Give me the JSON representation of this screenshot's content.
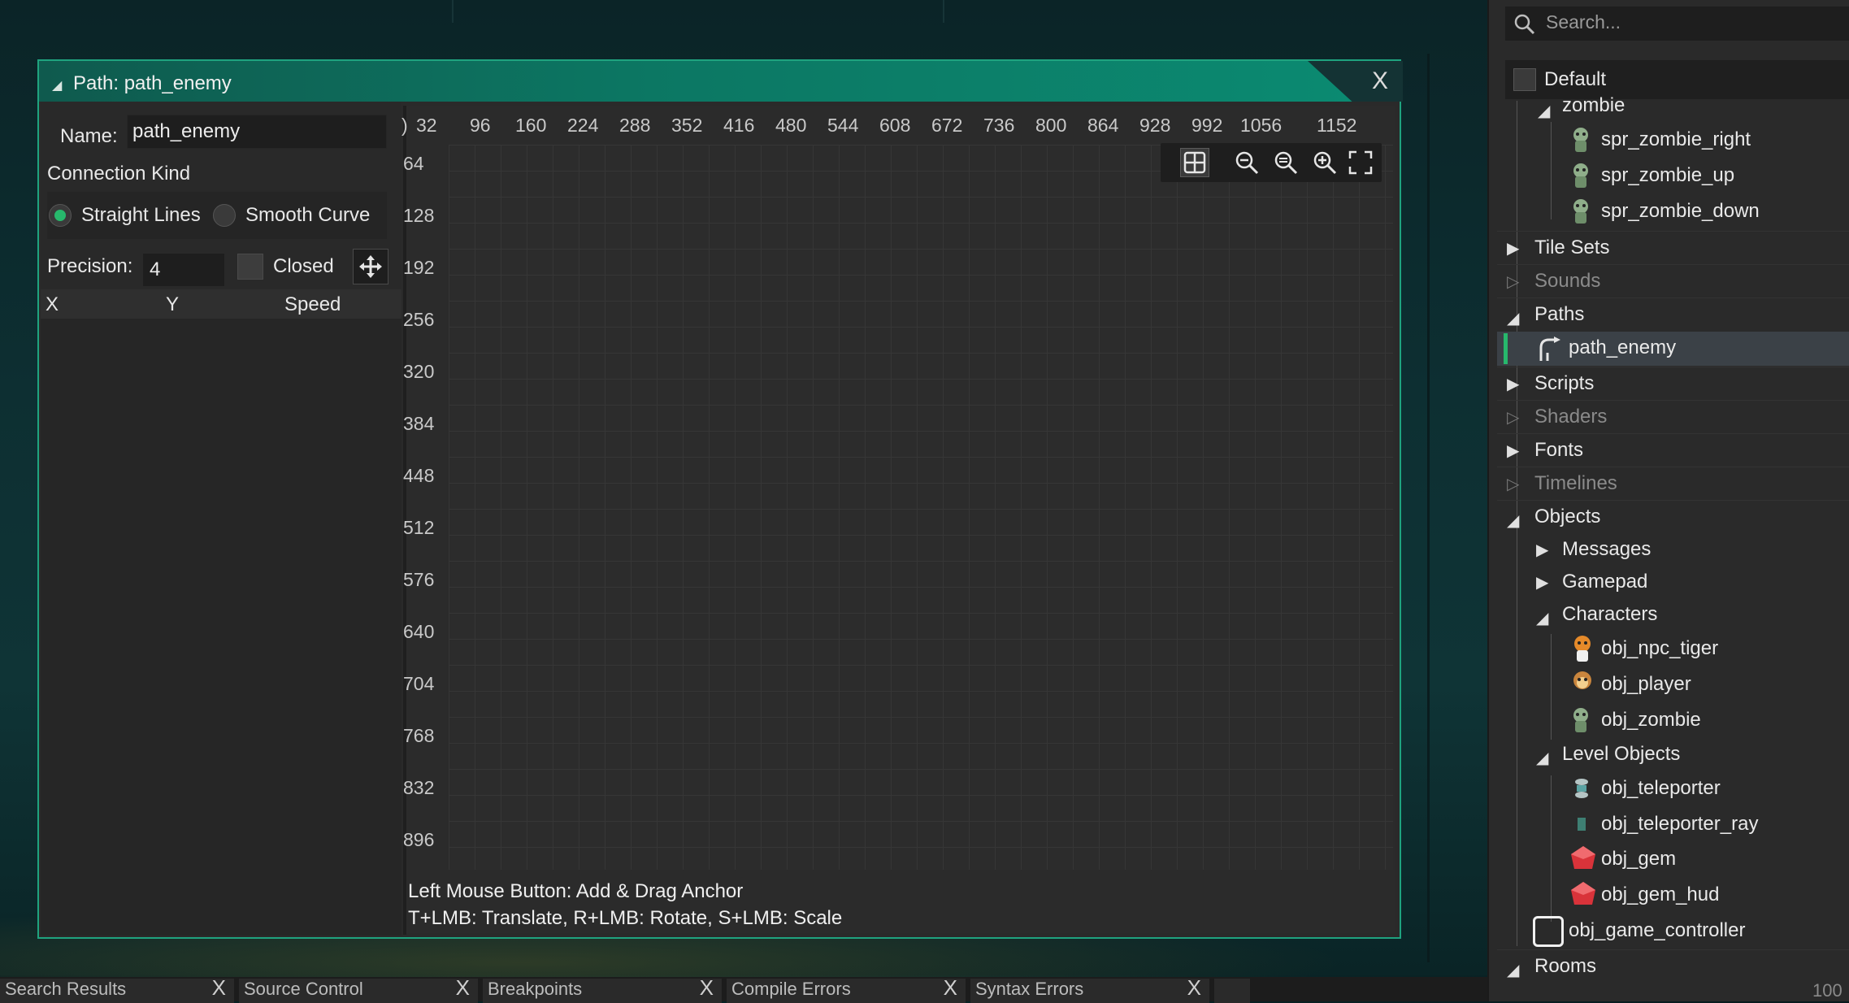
{
  "window": {
    "title": "Path: path_enemy",
    "close_label": "X"
  },
  "properties": {
    "name_label": "Name:",
    "name_value": "path_enemy",
    "connection_kind_label": "Connection Kind",
    "option_straight": "Straight Lines",
    "option_smooth": "Smooth Curve",
    "selected_option": "Straight Lines",
    "precision_label": "Precision:",
    "precision_value": "4",
    "closed_label": "Closed",
    "closed_checked": false,
    "columns": [
      "X",
      "Y",
      "Speed"
    ]
  },
  "canvas": {
    "x_ticks": [
      "32",
      "96",
      "160",
      "224",
      "288",
      "352",
      "416",
      "480",
      "544",
      "608",
      "672",
      "736",
      "800",
      "864",
      "928",
      "992",
      "1056",
      "1152"
    ],
    "y_ticks": [
      "64",
      "128",
      "192",
      "256",
      "320",
      "384",
      "448",
      "512",
      "576",
      "640",
      "704",
      "768",
      "832",
      "896"
    ],
    "hint_line1": "Left Mouse Button: Add & Drag Anchor",
    "hint_line2": "T+LMB: Translate, R+LMB: Rotate, S+LMB: Scale",
    "toolbar": [
      "grid-icon",
      "zoom-out-icon",
      "zoom-reset-icon",
      "zoom-in-icon",
      "fullscreen-icon"
    ]
  },
  "bottom_tabs": [
    "Search Results",
    "Source Control",
    "Breakpoints",
    "Compile Errors",
    "Syntax Errors"
  ],
  "sidebar": {
    "search_placeholder": "Search...",
    "group": "Default",
    "items": [
      {
        "label": "zombie",
        "level": 1,
        "type": "folder-open"
      },
      {
        "label": "spr_zombie_right",
        "level": 2,
        "type": "sprite"
      },
      {
        "label": "spr_zombie_up",
        "level": 2,
        "type": "sprite"
      },
      {
        "label": "spr_zombie_down",
        "level": 2,
        "type": "sprite"
      },
      {
        "label": "Tile Sets",
        "level": 0,
        "type": "folder-closed"
      },
      {
        "label": "Sounds",
        "level": 0,
        "type": "folder-empty"
      },
      {
        "label": "Paths",
        "level": 0,
        "type": "folder-open"
      },
      {
        "label": "path_enemy",
        "level": 1,
        "type": "path",
        "selected": true
      },
      {
        "label": "Scripts",
        "level": 0,
        "type": "folder-closed"
      },
      {
        "label": "Shaders",
        "level": 0,
        "type": "folder-empty"
      },
      {
        "label": "Fonts",
        "level": 0,
        "type": "folder-closed"
      },
      {
        "label": "Timelines",
        "level": 0,
        "type": "folder-empty"
      },
      {
        "label": "Objects",
        "level": 0,
        "type": "folder-open"
      },
      {
        "label": "Messages",
        "level": 1,
        "type": "folder-closed"
      },
      {
        "label": "Gamepad",
        "level": 1,
        "type": "folder-closed"
      },
      {
        "label": "Characters",
        "level": 1,
        "type": "folder-open"
      },
      {
        "label": "obj_npc_tiger",
        "level": 2,
        "type": "object"
      },
      {
        "label": "obj_player",
        "level": 2,
        "type": "object"
      },
      {
        "label": "obj_zombie",
        "level": 2,
        "type": "object"
      },
      {
        "label": "Level Objects",
        "level": 1,
        "type": "folder-open"
      },
      {
        "label": "obj_teleporter",
        "level": 2,
        "type": "object"
      },
      {
        "label": "obj_teleporter_ray",
        "level": 2,
        "type": "object"
      },
      {
        "label": "obj_gem",
        "level": 2,
        "type": "object"
      },
      {
        "label": "obj_gem_hud",
        "level": 2,
        "type": "object"
      },
      {
        "label": "obj_game_controller",
        "level": 1,
        "type": "object-empty"
      },
      {
        "label": "Rooms",
        "level": 0,
        "type": "folder-open"
      }
    ],
    "footer_value": "100"
  },
  "colors": {
    "accent": "#27b86c",
    "titlebar": "#0c7763",
    "window_border": "#1fa37f",
    "selected_row": "#3b4147"
  }
}
